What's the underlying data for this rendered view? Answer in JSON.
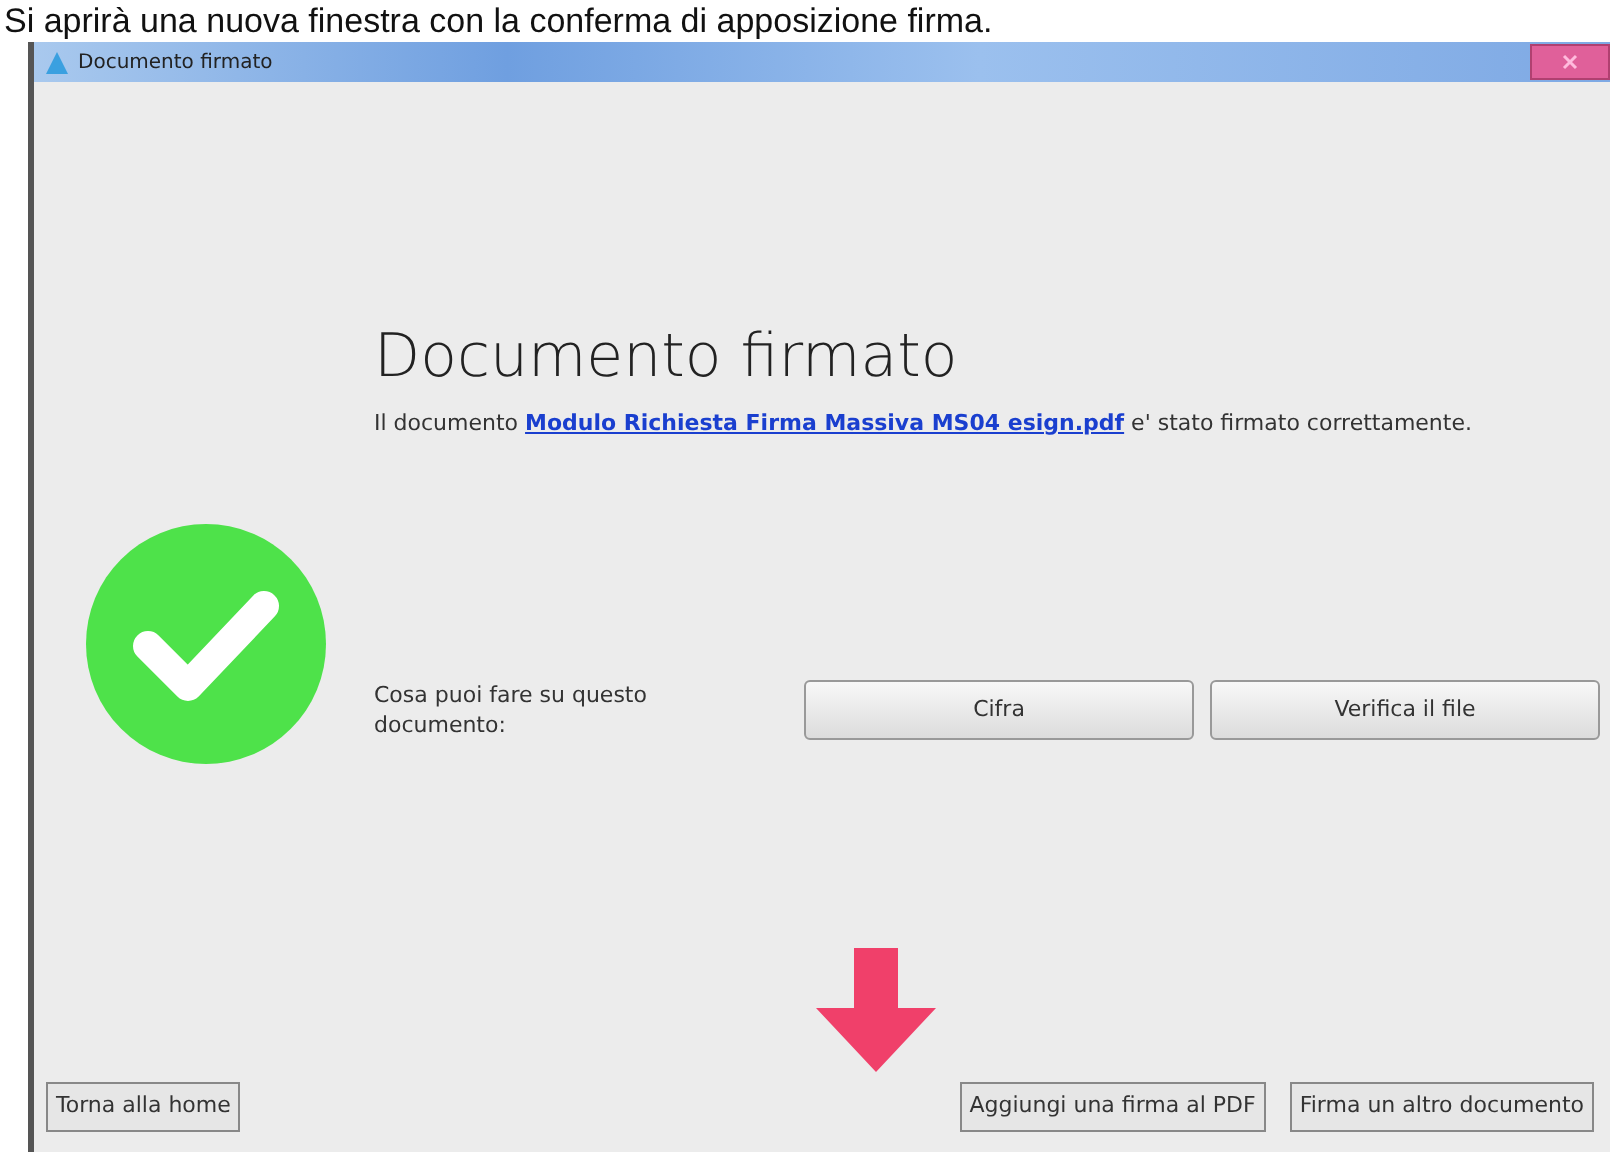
{
  "caption": "Si aprirà una nuova finestra con la conferma di apposizione firma.",
  "window": {
    "title": "Documento firmato"
  },
  "heading": "Documento firmato",
  "message": {
    "before": "Il documento ",
    "link": "Modulo Richiesta Firma Massiva MS04 esign.pdf",
    "after": " e' stato firmato correttamente."
  },
  "actions_label": "Cosa puoi fare su questo documento:",
  "action_buttons": [
    "Cifra",
    "Verifica il file"
  ],
  "footer_buttons": [
    "Torna alla home",
    "Aggiungi una firma al PDF",
    "Firma un altro documento"
  ]
}
